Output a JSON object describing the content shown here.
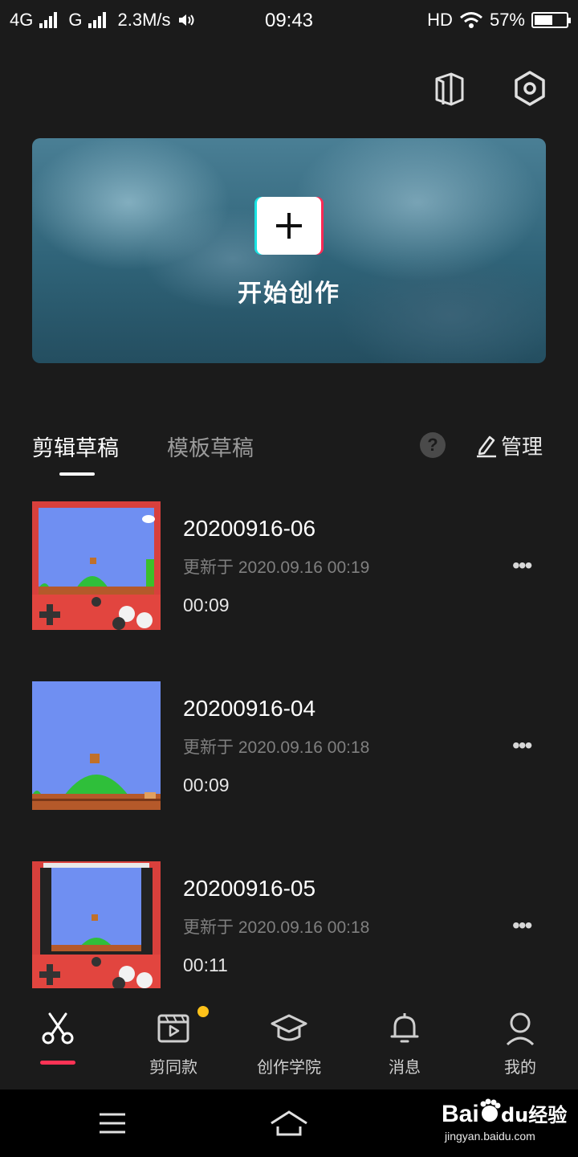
{
  "status_bar": {
    "network_1": "4G",
    "network_2": "G",
    "speed": "2.3M/s",
    "time": "09:43",
    "hd": "HD",
    "battery": "57%",
    "battery_level": 0.57
  },
  "top_icons": [
    "book-icon",
    "settings-hexagon-icon"
  ],
  "banner": {
    "title": "开始创作",
    "button_icon": "plus-icon"
  },
  "tabs": [
    {
      "label": "剪辑草稿",
      "active": true
    },
    {
      "label": "模板草稿",
      "active": false
    }
  ],
  "help_label": "?",
  "manage_label": "管理",
  "drafts": [
    {
      "title": "20200916-06",
      "updated": "更新于 2020.09.16 00:19",
      "duration": "00:09"
    },
    {
      "title": "20200916-04",
      "updated": "更新于 2020.09.16 00:18",
      "duration": "00:09"
    },
    {
      "title": "20200916-05",
      "updated": "更新于 2020.09.16 00:18",
      "duration": "00:11"
    }
  ],
  "more_label": "•••",
  "bottom_nav": [
    {
      "label": "",
      "icon": "scissors-icon",
      "active": true
    },
    {
      "label": "剪同款",
      "icon": "video-play-icon",
      "badge": true
    },
    {
      "label": "创作学院",
      "icon": "graduation-cap-icon"
    },
    {
      "label": "消息",
      "icon": "bell-icon"
    },
    {
      "label": "我的",
      "icon": "user-icon"
    }
  ],
  "watermark": {
    "text": "Baidu经验",
    "url_text": "jingyan.baidu.com"
  },
  "colors": {
    "background": "#1b1b1b",
    "accent_underline": "#ff3355",
    "badge": "#ffc21a"
  }
}
